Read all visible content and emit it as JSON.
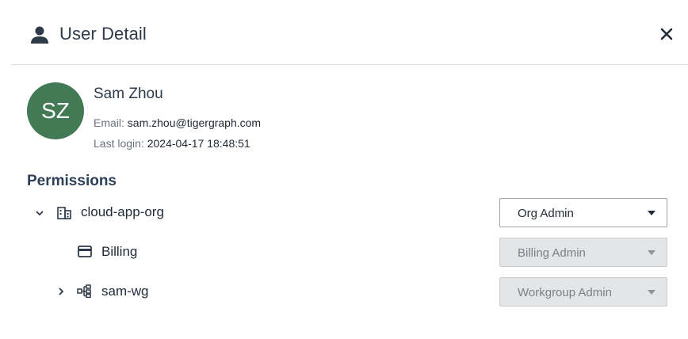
{
  "header": {
    "title": "User Detail",
    "person_icon": "person-icon",
    "close_icon": "close-icon"
  },
  "user": {
    "initials": "SZ",
    "avatar_color": "#427a56",
    "name": "Sam Zhou",
    "email_label": "Email:",
    "email": "sam.zhou@tigergraph.com",
    "last_login_label": "Last login:",
    "last_login": "2024-04-17 18:48:51"
  },
  "permissions": {
    "title": "Permissions",
    "rows": [
      {
        "name": "cloud-app-org",
        "icon": "building-icon",
        "expander": "chevron-down-icon",
        "role": "Org Admin",
        "disabled": false
      },
      {
        "name": "Billing",
        "icon": "credit-card-icon",
        "role": "Billing Admin",
        "disabled": true
      },
      {
        "name": "sam-wg",
        "icon": "workgroup-tree-icon",
        "expander": "chevron-right-icon",
        "role": "Workgroup Admin",
        "disabled": true
      }
    ]
  }
}
